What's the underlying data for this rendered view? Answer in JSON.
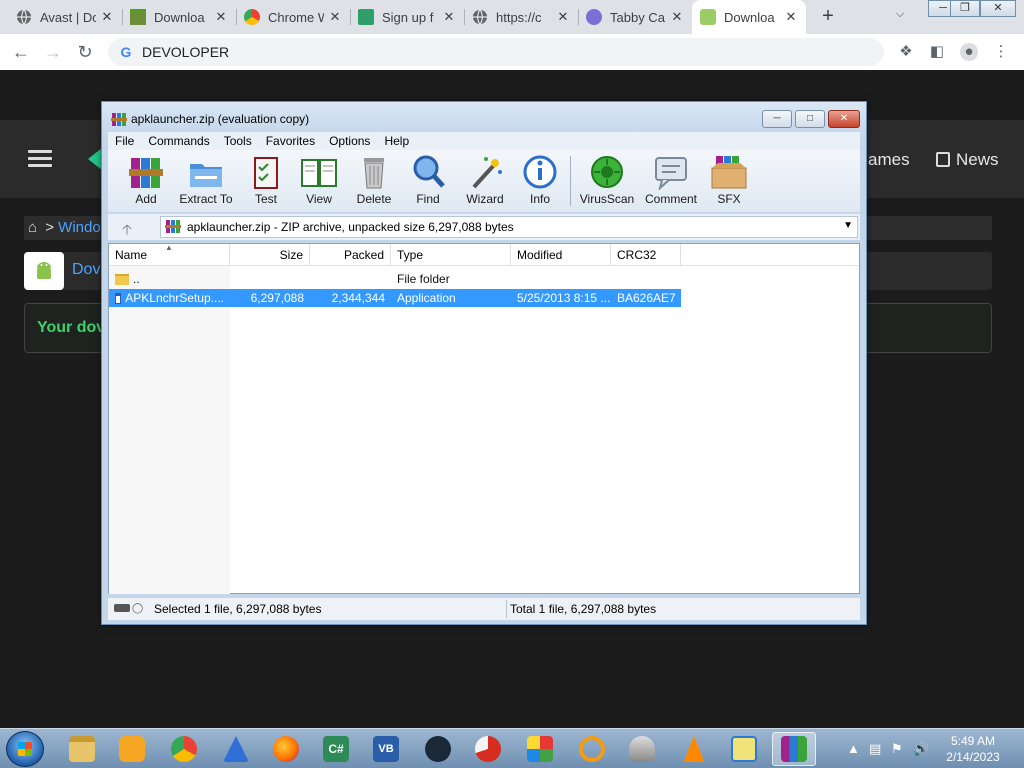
{
  "browser": {
    "tabs": [
      {
        "label": "Avast | Do",
        "icon": "globe-icon"
      },
      {
        "label": "Downloa",
        "icon": "minecraft-icon"
      },
      {
        "label": "Chrome W",
        "icon": "chrome-webstore-icon"
      },
      {
        "label": "Sign up f",
        "icon": "signup-icon"
      },
      {
        "label": "https://c",
        "icon": "globe-icon"
      },
      {
        "label": "Tabby Ca",
        "icon": "tabby-icon"
      },
      {
        "label": "Downloa",
        "icon": "download-site-icon"
      }
    ],
    "new_tab": "+",
    "tab_close": "✕",
    "address": "DEVOLOPER"
  },
  "site": {
    "nav_games": "ames",
    "nav_news": "News",
    "breadcrumb_text": "Windo",
    "breadcrumb_sep": ">",
    "app_title": "Dov",
    "download_msg": "Your dov"
  },
  "winrar": {
    "title": "apklauncher.zip (evaluation copy)",
    "menu": [
      "File",
      "Commands",
      "Tools",
      "Favorites",
      "Options",
      "Help"
    ],
    "toolbar": [
      {
        "label": "Add",
        "icon": "add-archive-icon"
      },
      {
        "label": "Extract To",
        "icon": "extract-folder-icon"
      },
      {
        "label": "Test",
        "icon": "test-checklist-icon"
      },
      {
        "label": "View",
        "icon": "view-book-icon"
      },
      {
        "label": "Delete",
        "icon": "trash-icon"
      },
      {
        "label": "Find",
        "icon": "magnifier-icon"
      },
      {
        "label": "Wizard",
        "icon": "wand-icon"
      },
      {
        "label": "Info",
        "icon": "info-icon"
      },
      {
        "label": "VirusScan",
        "icon": "virus-scan-icon"
      },
      {
        "label": "Comment",
        "icon": "comment-icon"
      },
      {
        "label": "SFX",
        "icon": "sfx-box-icon"
      }
    ],
    "path": "apklauncher.zip - ZIP archive, unpacked size 6,297,088 bytes",
    "columns": [
      "Name",
      "Size",
      "Packed",
      "Type",
      "Modified",
      "CRC32"
    ],
    "rows": [
      {
        "name": "..",
        "size": "",
        "packed": "",
        "type": "File folder",
        "modified": "",
        "crc": "",
        "selected": false
      },
      {
        "name": "APKLnchrSetup....",
        "size": "6,297,088",
        "packed": "2,344,344",
        "type": "Application",
        "modified": "5/25/2013 8:15 ...",
        "crc": "BA626AE7",
        "selected": true
      }
    ],
    "status_left": "Selected 1 file, 6,297,088 bytes",
    "status_right": "Total 1 file, 6,297,088 bytes"
  },
  "taskbar": {
    "apps": [
      "explorer",
      "media-player",
      "chrome",
      "sail",
      "firefox",
      "csharp",
      "vb",
      "steam",
      "ccleaner",
      "winrar-green",
      "search-tool",
      "pro-drive",
      "vlc",
      "notepad-check",
      "winrar"
    ],
    "time": "5:49 AM",
    "date": "2/14/2023"
  }
}
